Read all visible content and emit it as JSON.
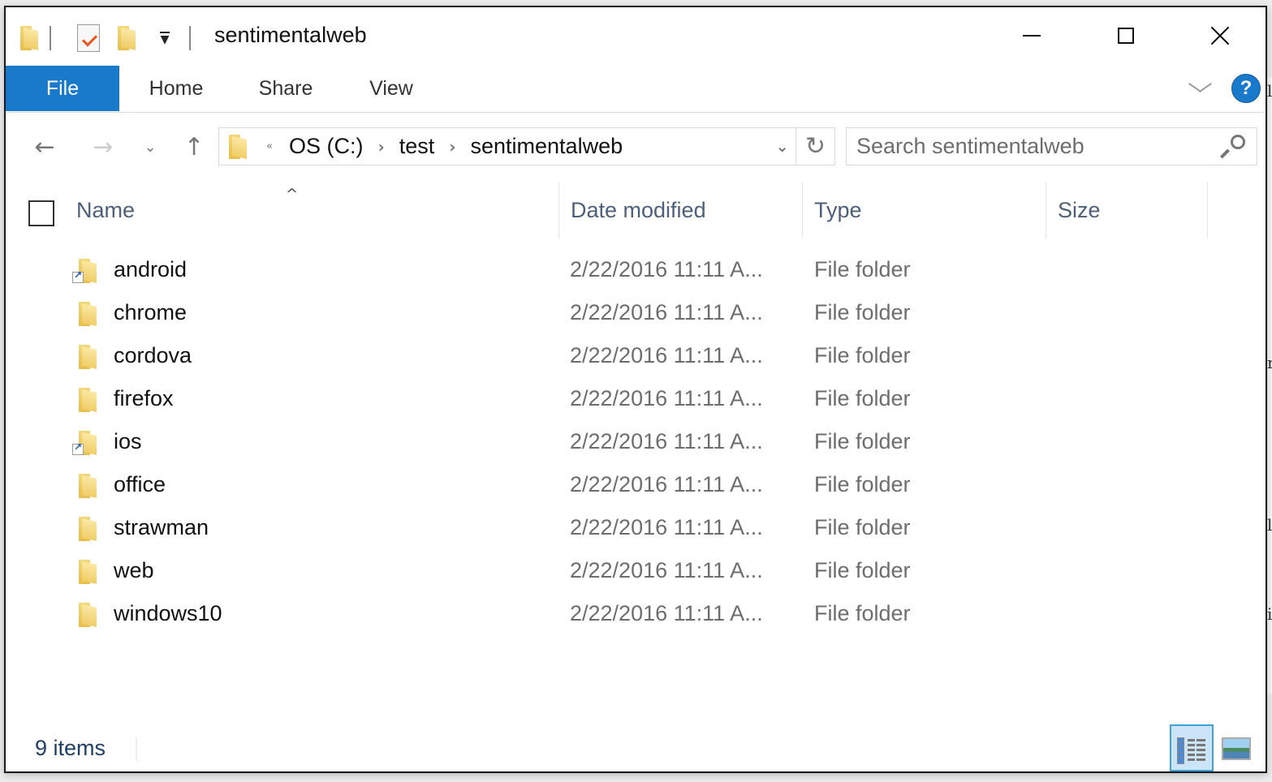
{
  "window": {
    "title": "sentimentalweb",
    "controls": {
      "minimize": "minimize",
      "maximize": "maximize",
      "close": "close"
    }
  },
  "quick_access": {
    "icons": [
      "folder-icon",
      "properties-icon",
      "new-folder-icon",
      "customize-dropdown-icon"
    ]
  },
  "ribbon": {
    "tabs": [
      {
        "label": "File",
        "active": true
      },
      {
        "label": "Home"
      },
      {
        "label": "Share"
      },
      {
        "label": "View"
      }
    ],
    "help_label": "?"
  },
  "navigation": {
    "breadcrumb": [
      {
        "label": "OS (C:)"
      },
      {
        "label": "test"
      },
      {
        "label": "sentimentalweb"
      }
    ],
    "overflow_glyph": "«",
    "search_placeholder": "Search sentimentalweb"
  },
  "columns": {
    "name": "Name",
    "date_modified": "Date modified",
    "type": "Type",
    "size": "Size",
    "sort_indicator": "^"
  },
  "files": [
    {
      "name": "android",
      "date": "2/22/2016 11:11 A...",
      "type": "File folder",
      "size": "",
      "shortcut": true
    },
    {
      "name": "chrome",
      "date": "2/22/2016 11:11 A...",
      "type": "File folder",
      "size": "",
      "shortcut": false
    },
    {
      "name": "cordova",
      "date": "2/22/2016 11:11 A...",
      "type": "File folder",
      "size": "",
      "shortcut": false
    },
    {
      "name": "firefox",
      "date": "2/22/2016 11:11 A...",
      "type": "File folder",
      "size": "",
      "shortcut": false
    },
    {
      "name": "ios",
      "date": "2/22/2016 11:11 A...",
      "type": "File folder",
      "size": "",
      "shortcut": true
    },
    {
      "name": "office",
      "date": "2/22/2016 11:11 A...",
      "type": "File folder",
      "size": "",
      "shortcut": false
    },
    {
      "name": "strawman",
      "date": "2/22/2016 11:11 A...",
      "type": "File folder",
      "size": "",
      "shortcut": false
    },
    {
      "name": "web",
      "date": "2/22/2016 11:11 A...",
      "type": "File folder",
      "size": "",
      "shortcut": false
    },
    {
      "name": "windows10",
      "date": "2/22/2016 11:11 A...",
      "type": "File folder",
      "size": "",
      "shortcut": false
    }
  ],
  "status_bar": {
    "item_count": "9 items",
    "active_view": "details"
  },
  "colors": {
    "accent": "#1979ca",
    "folder": "#f0cd66",
    "header_text": "#4c607a",
    "secondary_text": "#6d6d6d",
    "selected_view_bg": "#cce4f7"
  }
}
